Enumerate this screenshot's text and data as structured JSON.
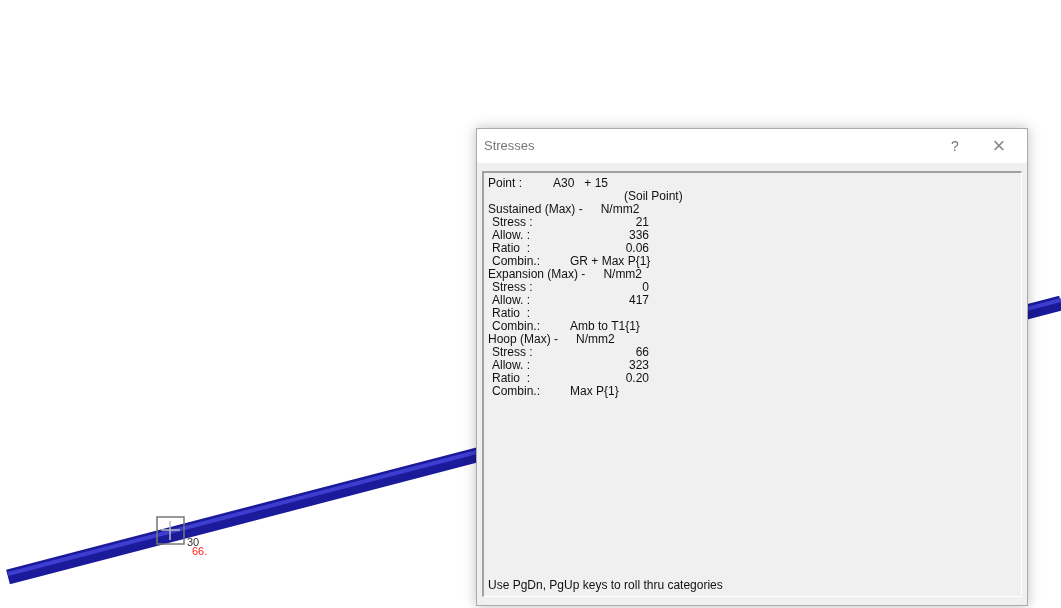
{
  "canvas": {
    "node_labels": [
      {
        "text": "30",
        "kind": "node"
      },
      {
        "text": "66.",
        "kind": "stress"
      }
    ]
  },
  "dialog": {
    "title": "Stresses",
    "help": "?",
    "close": "×",
    "lines": [
      {
        "kind": "point",
        "label": "Point :",
        "value": "A30   + 15"
      },
      {
        "kind": "note",
        "value": "(Soil Point)"
      },
      {
        "kind": "header",
        "label": "Sustained (Max) -",
        "value": "N/mm2"
      },
      {
        "kind": "value",
        "label": "Stress :",
        "value": "21"
      },
      {
        "kind": "value",
        "label": "Allow. :",
        "value": "336"
      },
      {
        "kind": "value",
        "label": "Ratio  :",
        "value": "0.06"
      },
      {
        "kind": "combin",
        "label": "Combin.:",
        "value": "GR + Max P{1}"
      },
      {
        "kind": "header",
        "label": "Expansion (Max) -",
        "value": "N/mm2"
      },
      {
        "kind": "value",
        "label": "Stress :",
        "value": "0"
      },
      {
        "kind": "value",
        "label": "Allow. :",
        "value": "417"
      },
      {
        "kind": "value",
        "label": "Ratio  :"
      },
      {
        "kind": "combin",
        "label": "Combin.:",
        "value": "Amb to T1{1}"
      },
      {
        "kind": "header",
        "label": "Hoop (Max) -",
        "value": "N/mm2"
      },
      {
        "kind": "value",
        "label": "Stress :",
        "value": "66"
      },
      {
        "kind": "value",
        "label": "Allow. :",
        "value": "323"
      },
      {
        "kind": "value",
        "label": "Ratio  :",
        "value": "0.20"
      },
      {
        "kind": "combin",
        "label": "Combin.:",
        "value": "Max P{1}"
      }
    ],
    "hint": "Use PgDn, PgUp keys to roll thru categories"
  }
}
